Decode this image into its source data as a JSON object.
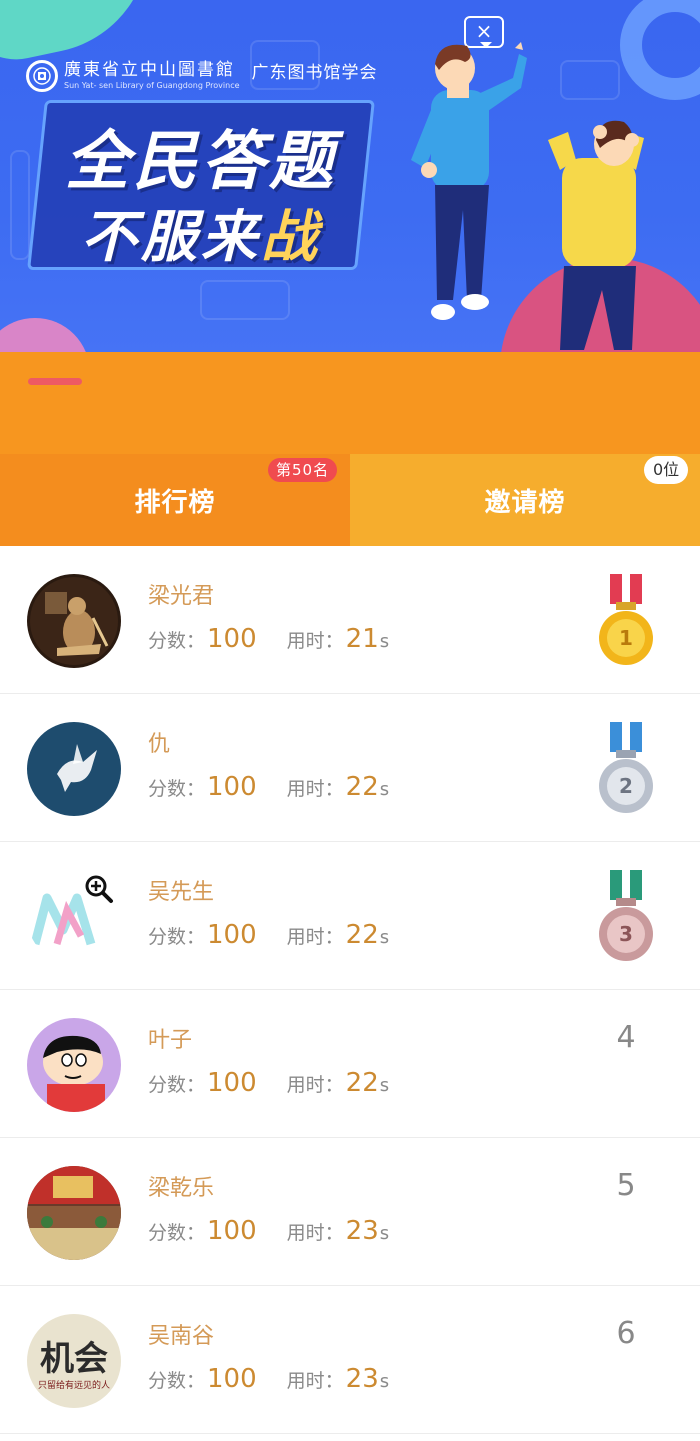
{
  "banner": {
    "logo_cn": "廣東省立中山圖書館",
    "logo_en": "Sun Yat- sen Library of Guangdong Province",
    "association": "广东图书馆学会",
    "title_line1": "全民答题",
    "title_line2_prefix": "不服来",
    "title_line2_highlight": "战",
    "speech_symbol": "×"
  },
  "tabs": [
    {
      "label": "排行榜",
      "badge": "第50名",
      "active": true
    },
    {
      "label": "邀请榜",
      "badge": "0位",
      "active": false
    }
  ],
  "labels": {
    "score": "分数：",
    "time": "用时：",
    "time_unit": "s"
  },
  "ranking": [
    {
      "rank": "1",
      "name": "梁光君",
      "score": "100",
      "time": "21",
      "medal": "gold"
    },
    {
      "rank": "2",
      "name": "仇",
      "score": "100",
      "time": "22",
      "medal": "silver"
    },
    {
      "rank": "3",
      "name": "吴先生",
      "score": "100",
      "time": "22",
      "medal": "bronze"
    },
    {
      "rank": "4",
      "name": "叶子",
      "score": "100",
      "time": "22",
      "medal": ""
    },
    {
      "rank": "5",
      "name": "梁乾乐",
      "score": "100",
      "time": "23",
      "medal": ""
    },
    {
      "rank": "6",
      "name": "吴南谷",
      "score": "100",
      "time": "23",
      "medal": ""
    }
  ],
  "avatar_texts": {
    "row6_big": "机会",
    "row6_small": "只留给有远见的人"
  },
  "colors": {
    "orange_tab": "#f48d1e",
    "invite_tab": "#f6ad2d",
    "name": "#d49a57",
    "value": "#cc8a31",
    "badge_red": "#f04b4f",
    "banner_blue": "#3d6cf2"
  },
  "icons": {
    "medal_1": "gold-medal-icon",
    "medal_2": "silver-medal-icon",
    "medal_3": "bronze-medal-icon",
    "zoom": "zoom-in-icon",
    "speech": "close-speech-icon"
  }
}
